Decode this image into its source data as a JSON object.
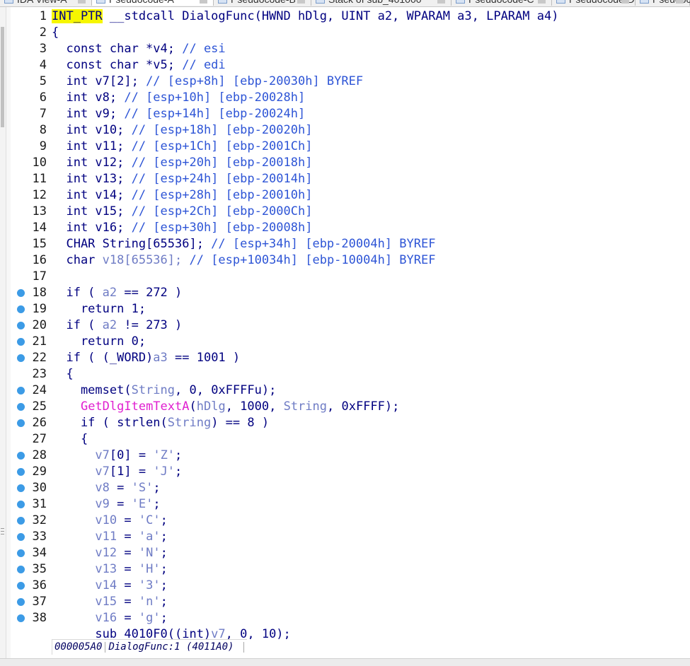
{
  "tabs": [
    {
      "label": "IDA View-A"
    },
    {
      "label": "Pseudocode-A"
    },
    {
      "label": "Pseudocode-B"
    },
    {
      "label": "Stack of sub_401000"
    },
    {
      "label": "Pseudocode-C"
    },
    {
      "label": "Pseudocode-D"
    },
    {
      "label": "Pseudocode-E"
    }
  ],
  "code": {
    "lines": [
      {
        "n": "1",
        "bp": false,
        "segs": [
          {
            "c": "hl-type",
            "t": "INT_PTR"
          },
          {
            "c": "",
            "t": " __stdcall DialogFunc(HWND hDlg, UINT a2, WPARAM a3, LPARAM a4)"
          }
        ]
      },
      {
        "n": "2",
        "bp": false,
        "segs": [
          {
            "c": "",
            "t": "{"
          }
        ]
      },
      {
        "n": "3",
        "bp": false,
        "segs": [
          {
            "c": "",
            "t": "  const char *v4; "
          },
          {
            "c": "cm",
            "t": "// esi"
          }
        ]
      },
      {
        "n": "4",
        "bp": false,
        "segs": [
          {
            "c": "",
            "t": "  const char *v5; "
          },
          {
            "c": "cm",
            "t": "// edi"
          }
        ]
      },
      {
        "n": "5",
        "bp": false,
        "segs": [
          {
            "c": "",
            "t": "  int v7[2]; "
          },
          {
            "c": "cm",
            "t": "// [esp+8h] [ebp-20030h] BYREF"
          }
        ]
      },
      {
        "n": "6",
        "bp": false,
        "segs": [
          {
            "c": "",
            "t": "  int v8; "
          },
          {
            "c": "cm",
            "t": "// [esp+10h] [ebp-20028h]"
          }
        ]
      },
      {
        "n": "7",
        "bp": false,
        "segs": [
          {
            "c": "",
            "t": "  int v9; "
          },
          {
            "c": "cm",
            "t": "// [esp+14h] [ebp-20024h]"
          }
        ]
      },
      {
        "n": "8",
        "bp": false,
        "segs": [
          {
            "c": "",
            "t": "  int v10; "
          },
          {
            "c": "cm",
            "t": "// [esp+18h] [ebp-20020h]"
          }
        ]
      },
      {
        "n": "9",
        "bp": false,
        "segs": [
          {
            "c": "",
            "t": "  int v11; "
          },
          {
            "c": "cm",
            "t": "// [esp+1Ch] [ebp-2001Ch]"
          }
        ]
      },
      {
        "n": "10",
        "bp": false,
        "segs": [
          {
            "c": "",
            "t": "  int v12; "
          },
          {
            "c": "cm",
            "t": "// [esp+20h] [ebp-20018h]"
          }
        ]
      },
      {
        "n": "11",
        "bp": false,
        "segs": [
          {
            "c": "",
            "t": "  int v13; "
          },
          {
            "c": "cm",
            "t": "// [esp+24h] [ebp-20014h]"
          }
        ]
      },
      {
        "n": "12",
        "bp": false,
        "segs": [
          {
            "c": "",
            "t": "  int v14; "
          },
          {
            "c": "cm",
            "t": "// [esp+28h] [ebp-20010h]"
          }
        ]
      },
      {
        "n": "13",
        "bp": false,
        "segs": [
          {
            "c": "",
            "t": "  int v15; "
          },
          {
            "c": "cm",
            "t": "// [esp+2Ch] [ebp-2000Ch]"
          }
        ]
      },
      {
        "n": "14",
        "bp": false,
        "segs": [
          {
            "c": "",
            "t": "  int v16; "
          },
          {
            "c": "cm",
            "t": "// [esp+30h] [ebp-20008h]"
          }
        ]
      },
      {
        "n": "15",
        "bp": false,
        "segs": [
          {
            "c": "",
            "t": "  CHAR String[65536]; "
          },
          {
            "c": "cm",
            "t": "// [esp+34h] [ebp-20004h] BYREF"
          }
        ]
      },
      {
        "n": "16",
        "bp": false,
        "segs": [
          {
            "c": "",
            "t": "  char "
          },
          {
            "c": "v",
            "t": "v18[65536]; "
          },
          {
            "c": "cm",
            "t": "// [esp+10034h] [ebp-10004h] BYREF"
          }
        ]
      },
      {
        "n": "17",
        "bp": false,
        "segs": [
          {
            "c": "",
            "t": ""
          }
        ]
      },
      {
        "n": "18",
        "bp": true,
        "segs": [
          {
            "c": "",
            "t": "  if ( "
          },
          {
            "c": "v",
            "t": "a2"
          },
          {
            "c": "",
            "t": " == 272 )"
          }
        ]
      },
      {
        "n": "19",
        "bp": true,
        "segs": [
          {
            "c": "",
            "t": "    return 1;"
          }
        ]
      },
      {
        "n": "20",
        "bp": true,
        "segs": [
          {
            "c": "",
            "t": "  if ( "
          },
          {
            "c": "v",
            "t": "a2"
          },
          {
            "c": "",
            "t": " != 273 )"
          }
        ]
      },
      {
        "n": "21",
        "bp": true,
        "segs": [
          {
            "c": "",
            "t": "    return 0;"
          }
        ]
      },
      {
        "n": "22",
        "bp": true,
        "segs": [
          {
            "c": "",
            "t": "  if ( (_WORD)"
          },
          {
            "c": "v",
            "t": "a3"
          },
          {
            "c": "",
            "t": " == 1001 )"
          }
        ]
      },
      {
        "n": "23",
        "bp": false,
        "segs": [
          {
            "c": "",
            "t": "  {"
          }
        ]
      },
      {
        "n": "24",
        "bp": true,
        "segs": [
          {
            "c": "",
            "t": "    memset("
          },
          {
            "c": "v",
            "t": "String"
          },
          {
            "c": "",
            "t": ", 0, 0xFFFFu);"
          }
        ]
      },
      {
        "n": "25",
        "bp": true,
        "segs": [
          {
            "c": "",
            "t": "    "
          },
          {
            "c": "fn",
            "t": "GetDlgItemTextA"
          },
          {
            "c": "",
            "t": "("
          },
          {
            "c": "v",
            "t": "hDlg"
          },
          {
            "c": "",
            "t": ", 1000, "
          },
          {
            "c": "v",
            "t": "String"
          },
          {
            "c": "",
            "t": ", 0xFFFF);"
          }
        ]
      },
      {
        "n": "26",
        "bp": true,
        "segs": [
          {
            "c": "",
            "t": "    if ( strlen("
          },
          {
            "c": "v",
            "t": "String"
          },
          {
            "c": "",
            "t": ") == 8 )"
          }
        ]
      },
      {
        "n": "27",
        "bp": false,
        "segs": [
          {
            "c": "",
            "t": "    {"
          }
        ]
      },
      {
        "n": "28",
        "bp": true,
        "segs": [
          {
            "c": "",
            "t": "      "
          },
          {
            "c": "v",
            "t": "v7"
          },
          {
            "c": "",
            "t": "[0] = "
          },
          {
            "c": "v",
            "t": "'Z'"
          },
          {
            "c": "",
            "t": ";"
          }
        ]
      },
      {
        "n": "29",
        "bp": true,
        "segs": [
          {
            "c": "",
            "t": "      "
          },
          {
            "c": "v",
            "t": "v7"
          },
          {
            "c": "",
            "t": "[1] = "
          },
          {
            "c": "v",
            "t": "'J'"
          },
          {
            "c": "",
            "t": ";"
          }
        ]
      },
      {
        "n": "30",
        "bp": true,
        "segs": [
          {
            "c": "",
            "t": "      "
          },
          {
            "c": "v",
            "t": "v8"
          },
          {
            "c": "",
            "t": " = "
          },
          {
            "c": "v",
            "t": "'S'"
          },
          {
            "c": "",
            "t": ";"
          }
        ]
      },
      {
        "n": "31",
        "bp": true,
        "segs": [
          {
            "c": "",
            "t": "      "
          },
          {
            "c": "v",
            "t": "v9"
          },
          {
            "c": "",
            "t": " = "
          },
          {
            "c": "v",
            "t": "'E'"
          },
          {
            "c": "",
            "t": ";"
          }
        ]
      },
      {
        "n": "32",
        "bp": true,
        "segs": [
          {
            "c": "",
            "t": "      "
          },
          {
            "c": "v",
            "t": "v10"
          },
          {
            "c": "",
            "t": " = "
          },
          {
            "c": "v",
            "t": "'C'"
          },
          {
            "c": "",
            "t": ";"
          }
        ]
      },
      {
        "n": "33",
        "bp": true,
        "segs": [
          {
            "c": "",
            "t": "      "
          },
          {
            "c": "v",
            "t": "v11"
          },
          {
            "c": "",
            "t": " = "
          },
          {
            "c": "v",
            "t": "'a'"
          },
          {
            "c": "",
            "t": ";"
          }
        ]
      },
      {
        "n": "34",
        "bp": true,
        "segs": [
          {
            "c": "",
            "t": "      "
          },
          {
            "c": "v",
            "t": "v12"
          },
          {
            "c": "",
            "t": " = "
          },
          {
            "c": "v",
            "t": "'N'"
          },
          {
            "c": "",
            "t": ";"
          }
        ]
      },
      {
        "n": "35",
        "bp": true,
        "segs": [
          {
            "c": "",
            "t": "      "
          },
          {
            "c": "v",
            "t": "v13"
          },
          {
            "c": "",
            "t": " = "
          },
          {
            "c": "v",
            "t": "'H'"
          },
          {
            "c": "",
            "t": ";"
          }
        ]
      },
      {
        "n": "36",
        "bp": true,
        "segs": [
          {
            "c": "",
            "t": "      "
          },
          {
            "c": "v",
            "t": "v14"
          },
          {
            "c": "",
            "t": " = "
          },
          {
            "c": "v",
            "t": "'3'"
          },
          {
            "c": "",
            "t": ";"
          }
        ]
      },
      {
        "n": "37",
        "bp": true,
        "segs": [
          {
            "c": "",
            "t": "      "
          },
          {
            "c": "v",
            "t": "v15"
          },
          {
            "c": "",
            "t": " = "
          },
          {
            "c": "v",
            "t": "'n'"
          },
          {
            "c": "",
            "t": ";"
          }
        ]
      },
      {
        "n": "38",
        "bp": true,
        "segs": [
          {
            "c": "",
            "t": "      "
          },
          {
            "c": "v",
            "t": "v16"
          },
          {
            "c": "",
            "t": " = "
          },
          {
            "c": "v",
            "t": "'g'"
          },
          {
            "c": "",
            "t": ";"
          }
        ]
      },
      {
        "n": "",
        "bp": false,
        "segs": [
          {
            "c": "",
            "t": "      sub_4010F0((int)"
          },
          {
            "c": "v",
            "t": "v7"
          },
          {
            "c": "",
            "t": ", 0, 10);"
          }
        ]
      }
    ]
  },
  "status": {
    "address": "000005A0",
    "location": "DialogFunc:1 (4011A0)"
  },
  "colors": {
    "default": "#000080",
    "variable": "#6f7cc5",
    "comment": "#2e55d6",
    "api_function": "#e01fd0",
    "highlight": "#f6f600",
    "breakpoint": "#3c9be6"
  },
  "icons": {
    "breakpoint": "breakpoint-dot-icon",
    "tab": "tab-view-icon",
    "tab_close": "close-icon"
  }
}
